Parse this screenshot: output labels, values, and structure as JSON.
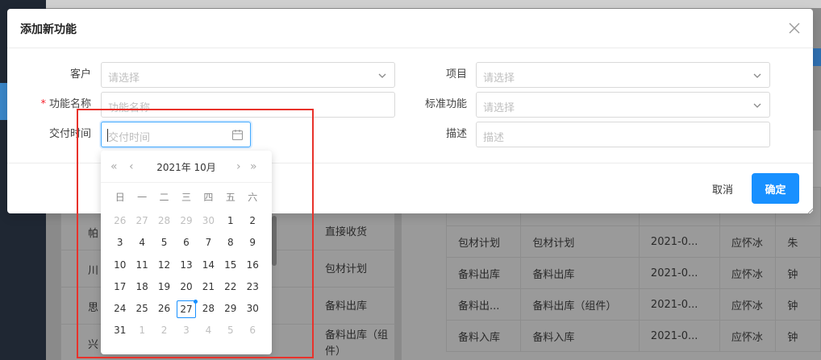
{
  "background": {
    "left_rows": [
      {
        "col1": "帕",
        "col2": "直接收货"
      },
      {
        "col1": "川",
        "col2": "包材计划"
      },
      {
        "col1": "思",
        "col2": "备料出库"
      },
      {
        "col1": "兴",
        "col2": "备料出库（组件）"
      }
    ],
    "table_rows": [
      [
        "包材计划",
        "包材计划",
        "2021-0...",
        "应怀冰",
        "朱"
      ],
      [
        "备料出库",
        "备料出库",
        "2021-0...",
        "应怀冰",
        "钟"
      ],
      [
        "备料出...",
        "备料出库（组件）",
        "2021-0...",
        "应怀冰",
        "钟"
      ],
      [
        "备料入库",
        "备料入库",
        "2021-0...",
        "应怀冰",
        "钟"
      ]
    ]
  },
  "dialog": {
    "title": "添加新功能",
    "fields": {
      "customer": {
        "label": "客户",
        "placeholder": "请选择"
      },
      "function_name": {
        "label": "功能名称",
        "placeholder": "功能名称",
        "required_mark": "*"
      },
      "delivery_time": {
        "label": "交付时间",
        "placeholder": "交付时间"
      },
      "project": {
        "label": "项目",
        "placeholder": "请选择"
      },
      "standard_function": {
        "label": "标准功能",
        "placeholder": "请选择"
      },
      "description": {
        "label": "描述",
        "placeholder": "描述"
      }
    },
    "cancel_label": "取消",
    "ok_label": "确定"
  },
  "datepicker": {
    "title": "2021年 10月",
    "nav": {
      "prev_year": "«",
      "prev_month": "‹",
      "next_month": "›",
      "next_year": "»"
    },
    "weekdays": [
      "日",
      "一",
      "二",
      "三",
      "四",
      "五",
      "六"
    ],
    "days": [
      {
        "d": "26",
        "muted": true
      },
      {
        "d": "27",
        "muted": true
      },
      {
        "d": "28",
        "muted": true
      },
      {
        "d": "29",
        "muted": true
      },
      {
        "d": "30",
        "muted": true
      },
      {
        "d": "1"
      },
      {
        "d": "2"
      },
      {
        "d": "3"
      },
      {
        "d": "4"
      },
      {
        "d": "5"
      },
      {
        "d": "6"
      },
      {
        "d": "7"
      },
      {
        "d": "8"
      },
      {
        "d": "9"
      },
      {
        "d": "10"
      },
      {
        "d": "11"
      },
      {
        "d": "12"
      },
      {
        "d": "13"
      },
      {
        "d": "14"
      },
      {
        "d": "15"
      },
      {
        "d": "16"
      },
      {
        "d": "17"
      },
      {
        "d": "18"
      },
      {
        "d": "19"
      },
      {
        "d": "20"
      },
      {
        "d": "21"
      },
      {
        "d": "22"
      },
      {
        "d": "23"
      },
      {
        "d": "24"
      },
      {
        "d": "25"
      },
      {
        "d": "26"
      },
      {
        "d": "27",
        "today": true
      },
      {
        "d": "28"
      },
      {
        "d": "29"
      },
      {
        "d": "30"
      },
      {
        "d": "31"
      },
      {
        "d": "1",
        "muted": true
      },
      {
        "d": "2",
        "muted": true
      },
      {
        "d": "3",
        "muted": true
      },
      {
        "d": "4",
        "muted": true
      },
      {
        "d": "5",
        "muted": true
      },
      {
        "d": "6",
        "muted": true
      }
    ]
  },
  "colors": {
    "primary": "#1890ff",
    "required": "#f5222d",
    "annotation": "#e8322b"
  }
}
